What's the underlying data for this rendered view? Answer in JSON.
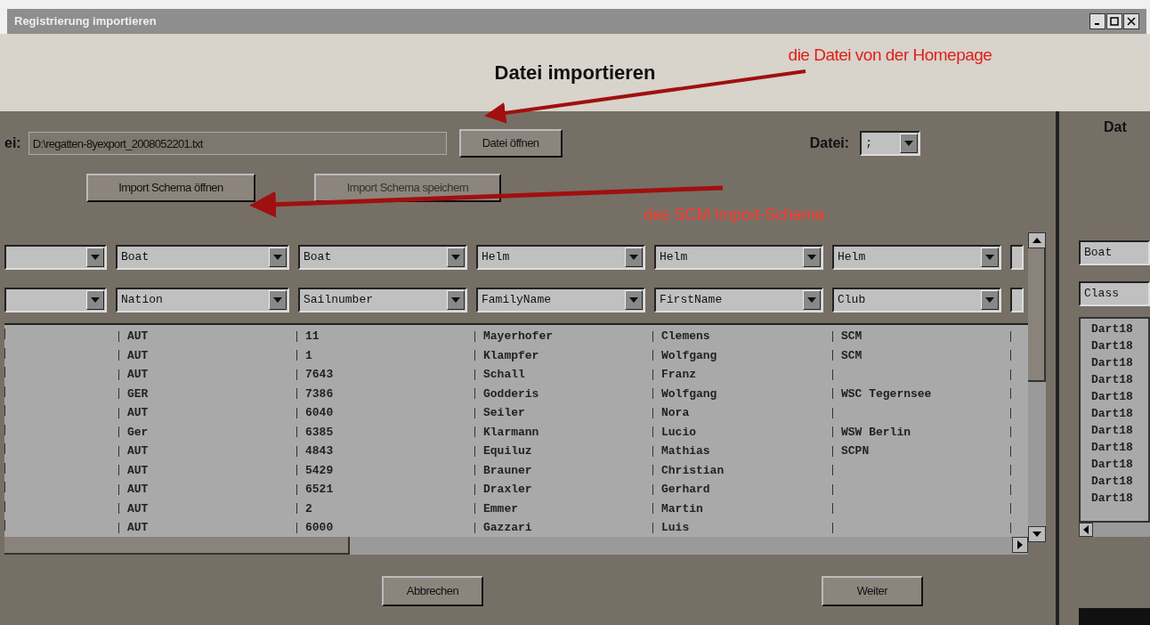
{
  "window": {
    "title": "Registrierung importieren"
  },
  "heading": "Datei importieren",
  "annotations": [
    {
      "text": "die Datei von der Homepage"
    },
    {
      "text": "das SCM Import-Schema"
    }
  ],
  "file_row": {
    "label": "ei:",
    "value": "D:\\regatten-8yexport_2008052201.txt",
    "open_button": "Datei öffnen",
    "separator_label": "Datei:",
    "separator_value": ";"
  },
  "schema_buttons": [
    "Import Schema öffnen",
    "Import Schema speichern"
  ],
  "mapping_row_1": [
    "Boat",
    "Boat",
    "Helm",
    "Helm",
    "Helm"
  ],
  "mapping_row_2": [
    "Nation",
    "Sailnumber",
    "FamilyName",
    "FirstName",
    "Club"
  ],
  "table": {
    "rows": [
      [
        "AUT",
        "11",
        "Mayerhofer",
        "Clemens",
        "SCM"
      ],
      [
        "AUT",
        "1",
        "Klampfer",
        "Wolfgang",
        "SCM"
      ],
      [
        "AUT",
        "7643",
        "Schall",
        "Franz",
        ""
      ],
      [
        "GER",
        "7386",
        "Godderis",
        "Wolfgang",
        "WSC Tegernsee"
      ],
      [
        "AUT",
        "6040",
        "Seiler",
        "Nora",
        ""
      ],
      [
        "Ger",
        "6385",
        "Klarmann",
        "Lucio",
        "WSW Berlin"
      ],
      [
        "AUT",
        "4843",
        "Equiluz",
        "Mathias",
        "SCPN"
      ],
      [
        "AUT",
        "5429",
        "Brauner",
        "Christian",
        ""
      ],
      [
        "AUT",
        "6521",
        "Draxler",
        "Gerhard",
        ""
      ],
      [
        "AUT",
        "2",
        "Emmer",
        "Martin",
        ""
      ],
      [
        "AUT",
        "6000",
        "Gazzari",
        "Luis",
        ""
      ]
    ]
  },
  "footer_buttons": [
    "Abbrechen",
    "Weiter"
  ],
  "right_panel": {
    "heading": "Dat",
    "combos": [
      "Boat",
      "Class"
    ],
    "list": [
      "Dart18",
      "Dart18",
      "Dart18",
      "Dart18",
      "Dart18",
      "Dart18",
      "Dart18",
      "Dart18",
      "Dart18",
      "Dart18",
      "Dart18"
    ]
  }
}
